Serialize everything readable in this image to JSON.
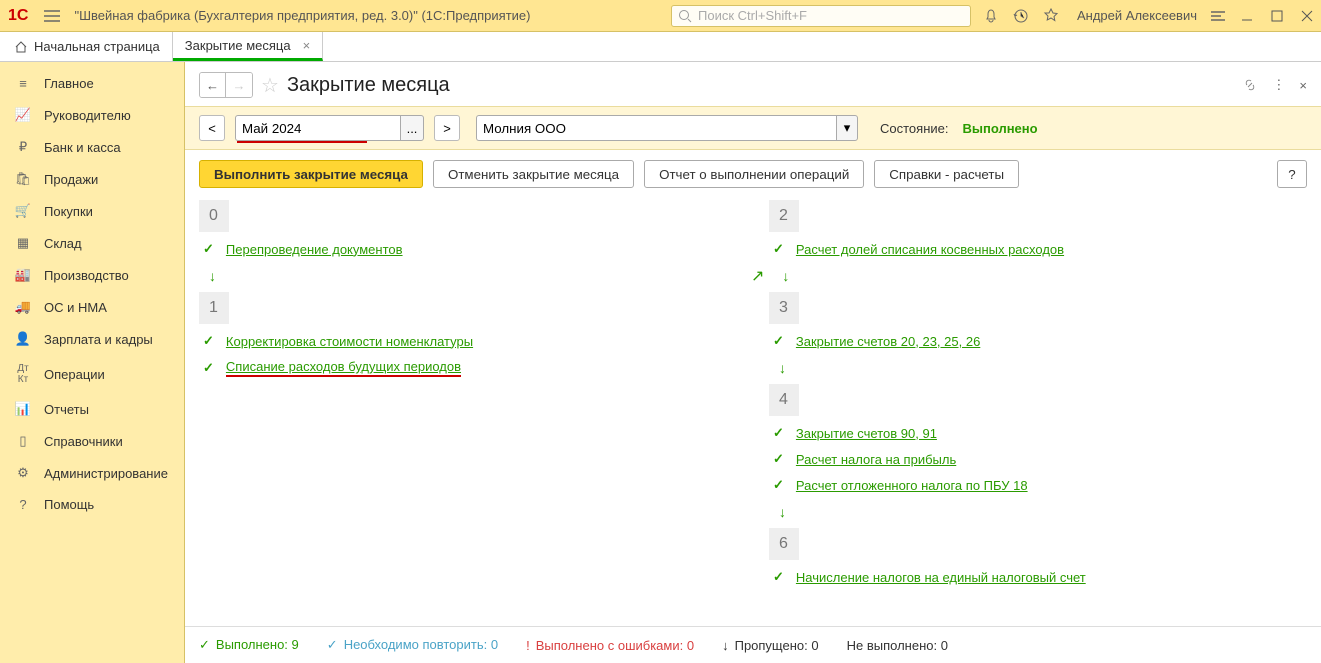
{
  "titlebar": {
    "app_title": "\"Швейная фабрика (Бухгалтерия предприятия, ред. 3.0)\"  (1С:Предприятие)",
    "search_placeholder": "Поиск Ctrl+Shift+F",
    "user": "Андрей Алексеевич"
  },
  "tabs": {
    "home": "Начальная страница",
    "active": "Закрытие месяца"
  },
  "sidebar": [
    "Главное",
    "Руководителю",
    "Банк и касса",
    "Продажи",
    "Покупки",
    "Склад",
    "Производство",
    "ОС и НМА",
    "Зарплата и кадры",
    "Операции",
    "Отчеты",
    "Справочники",
    "Администрирование",
    "Помощь"
  ],
  "page": {
    "title": "Закрытие месяца"
  },
  "toolbar": {
    "period": "Май 2024",
    "org": "Молния ООО",
    "state_label": "Состояние:",
    "state_value": "Выполнено",
    "btn_run": "Выполнить закрытие месяца",
    "btn_cancel": "Отменить закрытие месяца",
    "btn_report": "Отчет о выполнении операций",
    "btn_refs": "Справки - расчеты",
    "btn_help": "?"
  },
  "stages": {
    "s0": {
      "num": "0",
      "ops": [
        "Перепроведение документов"
      ]
    },
    "s1": {
      "num": "1",
      "ops": [
        "Корректировка стоимости номенклатуры",
        "Списание расходов будущих периодов"
      ]
    },
    "s2": {
      "num": "2",
      "ops": [
        "Расчет долей списания косвенных расходов"
      ]
    },
    "s3": {
      "num": "3",
      "ops": [
        "Закрытие счетов 20, 23, 25, 26"
      ]
    },
    "s4": {
      "num": "4",
      "ops": [
        "Закрытие счетов 90, 91",
        "Расчет налога на прибыль",
        "Расчет отложенного налога по ПБУ 18"
      ]
    },
    "s6": {
      "num": "6",
      "ops": [
        "Начисление налогов на единый налоговый счет"
      ]
    }
  },
  "footer": {
    "done_label": "Выполнено:",
    "done": "9",
    "repeat_label": "Необходимо повторить:",
    "repeat": "0",
    "errors_label": "Выполнено с ошибками:",
    "errors": "0",
    "skipped_label": "Пропущено:",
    "skipped": "0",
    "notdone_label": "Не выполнено:",
    "notdone": "0"
  }
}
